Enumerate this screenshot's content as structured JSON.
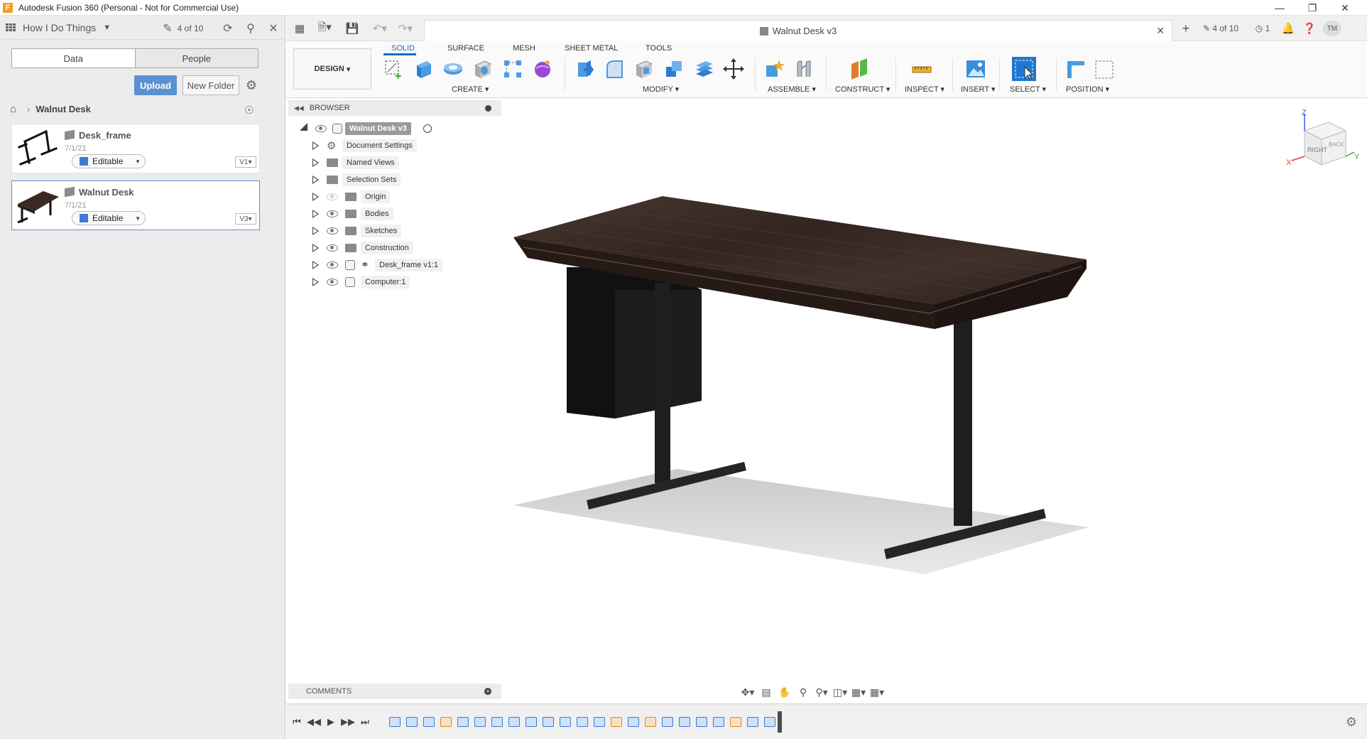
{
  "window": {
    "title": "Autodesk Fusion 360 (Personal - Not for Commercial Use)",
    "logo_letter": "F",
    "controls": [
      "—",
      "❐",
      "✕"
    ]
  },
  "data_panel": {
    "project_name": "How I Do Things",
    "file_count": "4 of 10",
    "tabs": [
      "Data",
      "People"
    ],
    "upload_label": "Upload",
    "new_folder_label": "New Folder",
    "breadcrumb": "Walnut Desk",
    "files": [
      {
        "name": "Desk_frame",
        "date": "7/1/21",
        "status": "Editable",
        "version": "V1"
      },
      {
        "name": "Walnut Desk",
        "date": "7/1/21",
        "status": "Editable",
        "version": "V3"
      }
    ]
  },
  "app_row": {
    "document_tab": "Walnut Desk v3",
    "file_count": "4 of 10",
    "job_count": "1",
    "user_initials": "TM"
  },
  "ribbon": {
    "workspace": "DESIGN",
    "tabs": [
      "SOLID",
      "SURFACE",
      "MESH",
      "SHEET METAL",
      "TOOLS"
    ],
    "active_tab": "SOLID",
    "groups": [
      "CREATE",
      "MODIFY",
      "ASSEMBLE",
      "CONSTRUCT",
      "INSPECT",
      "INSERT",
      "SELECT",
      "POSITION"
    ]
  },
  "browser": {
    "header": "BROWSER",
    "root": "Walnut Desk v3",
    "items": [
      {
        "label": "Document Settings",
        "icon": "gear-icon"
      },
      {
        "label": "Named Views",
        "icon": "folder-icon"
      },
      {
        "label": "Selection Sets",
        "icon": "folder-icon"
      },
      {
        "label": "Origin",
        "icon": "folder-icon",
        "hidden": true
      },
      {
        "label": "Bodies",
        "icon": "folder-icon"
      },
      {
        "label": "Sketches",
        "icon": "folder-icon"
      },
      {
        "label": "Construction",
        "icon": "folder-icon"
      },
      {
        "label": "Desk_frame v1:1",
        "icon": "component-link-icon"
      },
      {
        "label": "Computer:1",
        "icon": "component-icon"
      }
    ]
  },
  "viewcube": {
    "right": "RIGHT",
    "back": "BACK",
    "x": "X",
    "y": "Y",
    "z": "Z"
  },
  "comments": {
    "label": "COMMENTS"
  },
  "colors": {
    "accent": "#1b6bc4",
    "upload": "#5a91d0",
    "desk_wood": "#3b2a24",
    "frame": "#1e1e1e"
  }
}
